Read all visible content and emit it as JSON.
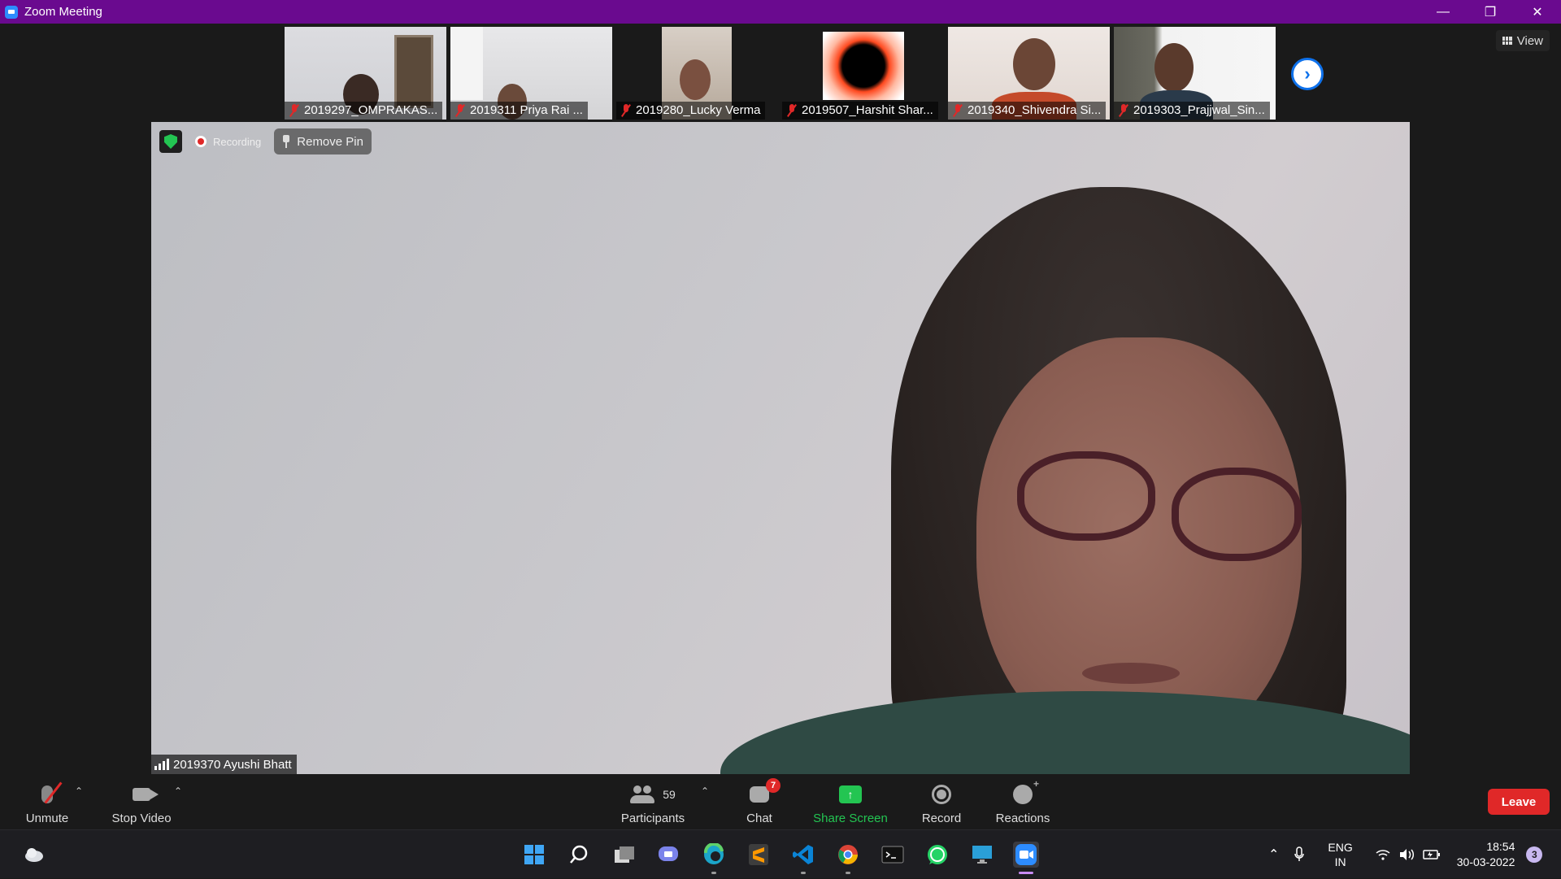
{
  "window": {
    "title": "Zoom Meeting"
  },
  "thumbnails": [
    {
      "name": "2019297_OMPRAKAS...",
      "bg": "#d8d8dc"
    },
    {
      "name": "2019311 Priya Rai ...",
      "bg": "#e4e4e4"
    },
    {
      "name": "2019280_Lucky Verma",
      "bg": "#1a1a1a"
    },
    {
      "name": "2019507_Harshit Shar...",
      "bg": "#1a1a1a"
    },
    {
      "name": "2019340_Shivendra Si...",
      "bg": "#e9e2de"
    },
    {
      "name": "2019303_Prajjwal_Sin...",
      "bg": "#efefef"
    }
  ],
  "view_button": {
    "label": "View"
  },
  "main_video": {
    "recording_label": "Recording",
    "remove_pin_label": "Remove Pin",
    "speaker_name": "2019370 Ayushi Bhatt"
  },
  "toolbar": {
    "unmute_label": "Unmute",
    "stop_video_label": "Stop Video",
    "participants_label": "Participants",
    "participants_count": "59",
    "chat_label": "Chat",
    "chat_badge": "7",
    "share_label": "Share Screen",
    "record_label": "Record",
    "reactions_label": "Reactions",
    "leave_label": "Leave",
    "share_color": "#23c552",
    "leave_color": "#e02828"
  },
  "taskbar": {
    "apps": [
      "start-icon",
      "search-icon",
      "task-view-icon",
      "teams-chat-icon",
      "edge-icon",
      "sublime-text-icon",
      "vscode-icon",
      "chrome-icon",
      "terminal-icon",
      "whatsapp-icon",
      "remote-desktop-icon",
      "zoom-icon"
    ],
    "lang_line1": "ENG",
    "lang_line2": "IN",
    "time": "18:54",
    "date": "30-03-2022",
    "notification_count": "3"
  }
}
